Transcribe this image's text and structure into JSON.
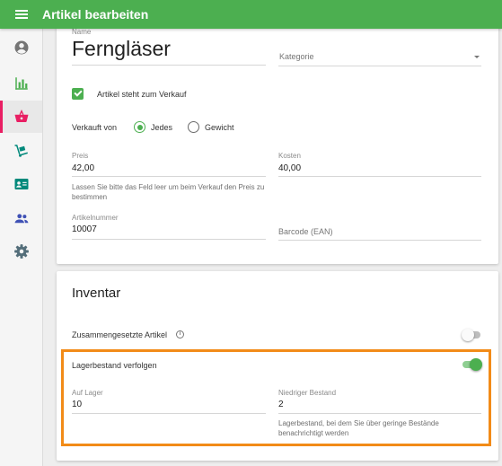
{
  "app": {
    "title": "Artikel bearbeiten"
  },
  "colors": {
    "primary": "#4caf50",
    "active_indicator": "#e91e63",
    "highlight": "#f28b18"
  },
  "sidebar": {
    "items": [
      {
        "name": "account",
        "icon": "account-circle-icon",
        "active": false
      },
      {
        "name": "reports",
        "icon": "bar-chart-icon",
        "active": false
      },
      {
        "name": "articles",
        "icon": "shopping-basket-icon",
        "active": true
      },
      {
        "name": "inventory",
        "icon": "dolly-icon",
        "active": false
      },
      {
        "name": "customers",
        "icon": "contact-card-icon",
        "active": false
      },
      {
        "name": "employees",
        "icon": "people-icon",
        "active": false
      },
      {
        "name": "settings",
        "icon": "gear-icon",
        "active": false
      }
    ]
  },
  "article": {
    "name_label": "Name",
    "name_value": "Ferngläser",
    "category_placeholder": "Kategorie",
    "for_sale_label": "Artikel steht zum Verkauf",
    "for_sale_checked": true,
    "sold_by_label": "Verkauft von",
    "sold_by_options": [
      "Jedes",
      "Gewicht"
    ],
    "sold_by_selected": "Jedes",
    "price_label": "Preis",
    "price_value": "42,00",
    "price_hint": "Lassen Sie bitte das Feld leer um beim Verkauf den Preis zu bestimmen",
    "cost_label": "Kosten",
    "cost_value": "40,00",
    "sku_label": "Artikelnummer",
    "sku_value": "10007",
    "barcode_placeholder": "Barcode (EAN)"
  },
  "inventory": {
    "title": "Inventar",
    "composite_label": "Zusammengesetzte Artikel",
    "composite_info_glyph": "i",
    "composite_enabled": false,
    "track_stock_label": "Lagerbestand verfolgen",
    "track_stock_enabled": true,
    "in_stock_label": "Auf Lager",
    "in_stock_value": "10",
    "low_stock_label": "Niedriger Bestand",
    "low_stock_value": "2",
    "low_stock_hint": "Lagerbestand, bei dem Sie über geringe Bestände benachrichtigt werden"
  }
}
